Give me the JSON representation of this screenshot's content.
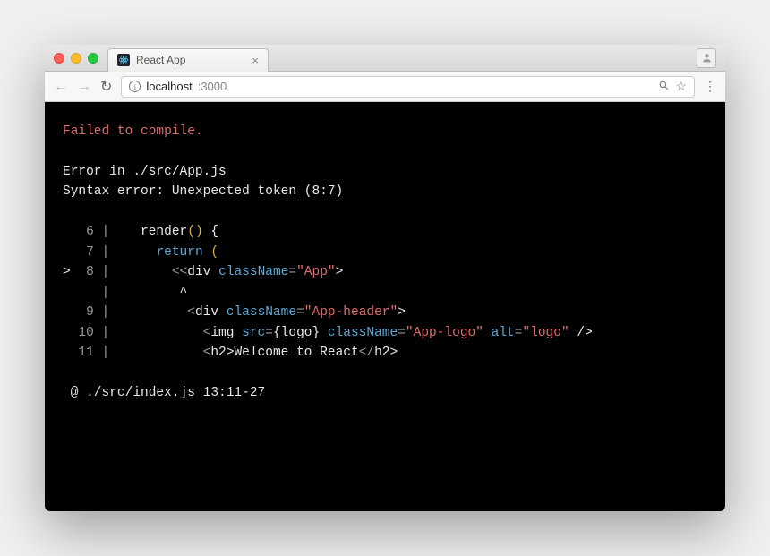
{
  "tab": {
    "title": "React App"
  },
  "address": {
    "host": "localhost",
    "port": ":3000"
  },
  "error": {
    "title": "Failed to compile.",
    "file": "Error in ./src/App.js",
    "message": "Syntax error: Unexpected token (8:7)",
    "footer": " @ ./src/index.js 13:11-27"
  },
  "code": {
    "lines": [
      {
        "num": "6",
        "marker": " ",
        "indent": "   ",
        "render": "render",
        "parens": "()",
        "brace": " {"
      },
      {
        "num": "7",
        "marker": " ",
        "indent": "     ",
        "return": "return",
        "paren_open": " ("
      },
      {
        "num": "8",
        "marker": ">",
        "indent": "       ",
        "d_lt": "<<",
        "tag": "div",
        "attr": "className",
        "eq": "=",
        "val": "\"App\"",
        "gt": ">"
      },
      {
        "num": "",
        "marker": " ",
        "caret_indent": "        ",
        "caret": "^"
      },
      {
        "num": "9",
        "marker": " ",
        "indent": "         ",
        "lt": "<",
        "tag": "div",
        "attr": "className",
        "eq": "=",
        "val": "\"App-header\"",
        "gt": ">"
      },
      {
        "num": "10",
        "marker": " ",
        "indent": "           ",
        "lt": "<",
        "tag": "img",
        "attr1": "src",
        "eq1": "=",
        "bval": "{logo}",
        "attr2": "className",
        "eq2": "=",
        "val2": "\"App-logo\"",
        "attr3": "alt",
        "eq3": "=",
        "val3": "\"logo\"",
        "slash": " /",
        "gt": ">"
      },
      {
        "num": "11",
        "marker": " ",
        "indent": "           ",
        "lt": "<",
        "tag": "h2",
        "gt": ">",
        "text": "Welcome to React",
        "lt2": "</",
        "tag2": "h2",
        "gt2": ">"
      }
    ]
  }
}
